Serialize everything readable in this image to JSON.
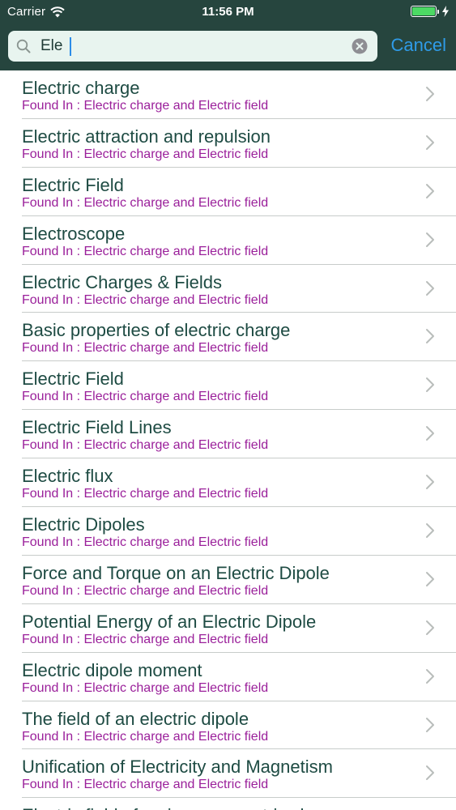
{
  "status_bar": {
    "carrier": "Carrier",
    "time": "11:56 PM",
    "battery_level": 1.0,
    "battery_color": "#4cd964"
  },
  "search": {
    "value": "Ele",
    "cancel_label": "Cancel",
    "icons": {
      "search": "search-icon",
      "clear": "clear-icon"
    }
  },
  "colors": {
    "header_bg": "#26453e",
    "title_text": "#1e4b43",
    "subtitle_text": "#9a1f9a",
    "accent": "#2f9be8"
  },
  "results": [
    {
      "title": "Electric charge",
      "subtitle": "Found In : Electric charge and Electric field"
    },
    {
      "title": "Electric attraction and repulsion",
      "subtitle": "Found In : Electric charge and Electric field"
    },
    {
      "title": "Electric Field",
      "subtitle": "Found In : Electric charge and Electric field"
    },
    {
      "title": "Electroscope",
      "subtitle": "Found In : Electric charge and Electric field"
    },
    {
      "title": "Electric Charges & Fields",
      "subtitle": "Found In : Electric charge and Electric field"
    },
    {
      "title": "Basic properties of electric charge",
      "subtitle": "Found In : Electric charge and Electric field"
    },
    {
      "title": "Electric Field",
      "subtitle": "Found In : Electric charge and Electric field"
    },
    {
      "title": "Electric Field Lines",
      "subtitle": "Found In : Electric charge and Electric field"
    },
    {
      "title": "Electric flux",
      "subtitle": "Found In : Electric charge and Electric field"
    },
    {
      "title": "Electric Dipoles",
      "subtitle": "Found In : Electric charge and Electric field"
    },
    {
      "title": "Force and Torque on an Electric Dipole",
      "subtitle": "Found In : Electric charge and Electric field"
    },
    {
      "title": "Potential Energy of an Electric Dipole",
      "subtitle": "Found In : Electric charge and Electric field"
    },
    {
      "title": "Electric dipole moment",
      "subtitle": "Found In : Electric charge and Electric field"
    },
    {
      "title": "The field of an electric dipole",
      "subtitle": "Found In : Electric charge and Electric field"
    },
    {
      "title": "Unification of Electricity and Magnetism",
      "subtitle": "Found In : Electric charge and Electric field"
    },
    {
      "title": "Electric field of various symmetric charge",
      "subtitle": ""
    }
  ]
}
